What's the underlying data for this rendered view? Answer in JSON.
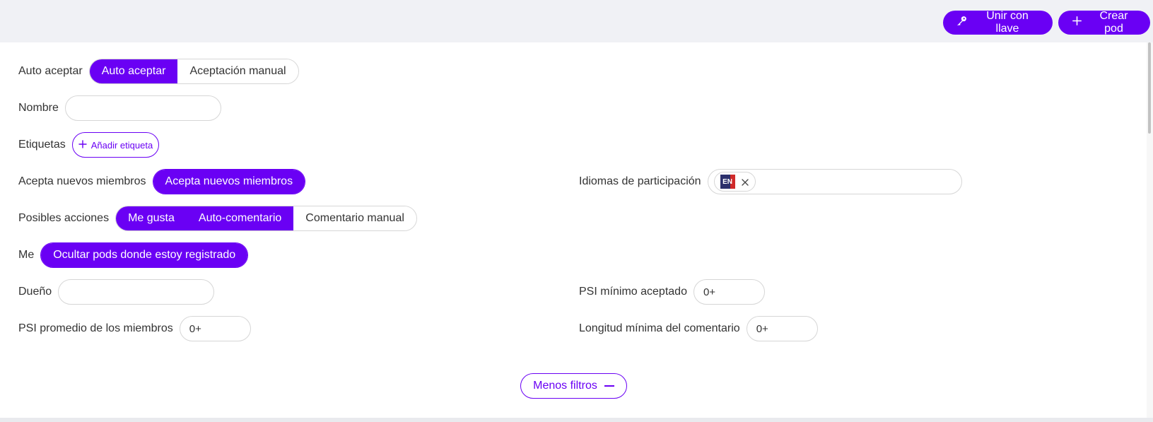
{
  "toolbar": {
    "join_label": "Unir con llave",
    "create_label": "Crear pod"
  },
  "filters": {
    "auto_accept": {
      "label": "Auto aceptar",
      "options": [
        "Auto aceptar",
        "Aceptación manual"
      ],
      "selected": "Auto aceptar"
    },
    "name": {
      "label": "Nombre",
      "value": ""
    },
    "tags": {
      "label": "Etiquetas",
      "add_label": "Añadir etiqueta"
    },
    "new_members": {
      "label": "Acepta nuevos miembros",
      "option": "Acepta nuevos miembros",
      "selected": true
    },
    "languages": {
      "label": "Idiomas de participación",
      "chips": [
        {
          "code": "EN"
        }
      ]
    },
    "actions": {
      "label": "Posibles acciones",
      "options": [
        "Me gusta",
        "Auto-comentario",
        "Comentario manual"
      ],
      "selected": [
        "Me gusta",
        "Auto-comentario"
      ]
    },
    "me": {
      "label": "Me",
      "option": "Ocultar pods donde estoy registrado",
      "selected": true
    },
    "owner": {
      "label": "Dueño",
      "value": ""
    },
    "min_psi": {
      "label": "PSI mínimo aceptado",
      "value": "0+"
    },
    "avg_psi": {
      "label": "PSI promedio de los miembros",
      "value": "0+"
    },
    "min_comment_length": {
      "label": "Longitud mínima del comentario",
      "value": "0+"
    }
  },
  "less_filters_label": "Menos filtros",
  "colors": {
    "accent": "#6a00f4",
    "background": "#f0f1f5",
    "panel": "#ffffff",
    "border": "#d6d6d6"
  },
  "icons": {
    "join": "key-icon",
    "create": "plus-icon",
    "add_tag": "plus-icon",
    "chip_remove": "close-icon",
    "less_filters": "minus-icon"
  }
}
